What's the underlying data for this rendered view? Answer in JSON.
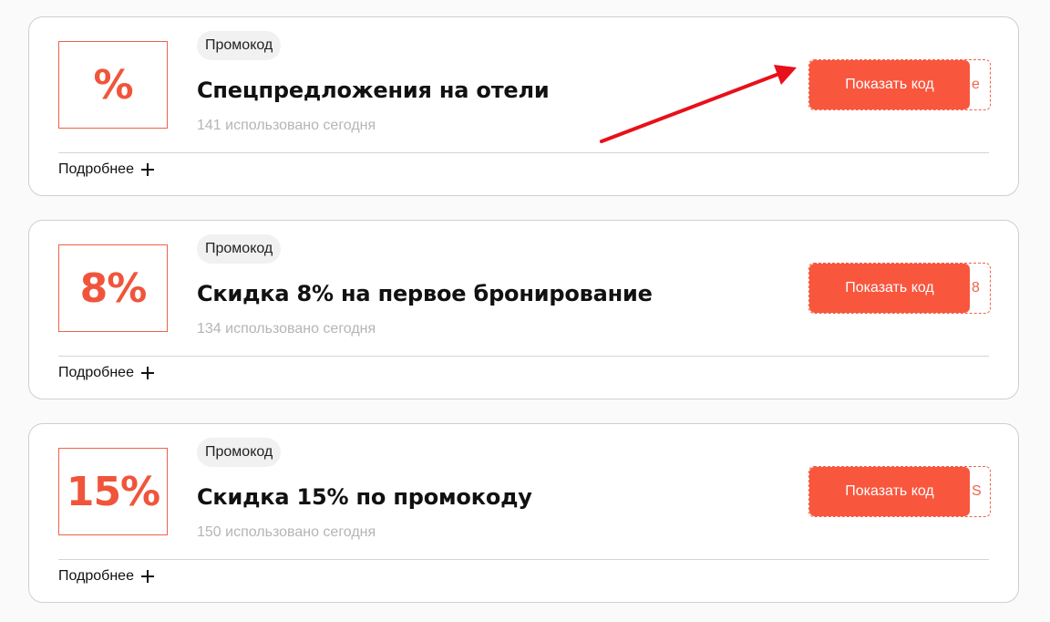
{
  "offers": [
    {
      "discount": "%",
      "badge": "Промокод",
      "title": "Спецпредложения на отели",
      "used": "141 использовано сегодня",
      "button_label": "Показать код",
      "code_peek": "e",
      "more_label": "Подробнее"
    },
    {
      "discount": "8%",
      "badge": "Промокод",
      "title": "Скидка 8% на первое бронирование",
      "used": "134 использовано сегодня",
      "button_label": "Показать код",
      "code_peek": "8",
      "more_label": "Подробнее"
    },
    {
      "discount": "15%",
      "badge": "Промокод",
      "title": "Скидка 15% по промокоду",
      "used": "150 использовано сегодня",
      "button_label": "Показать код",
      "code_peek": "S",
      "more_label": "Подробнее"
    }
  ],
  "colors": {
    "accent": "#f9563e",
    "annotation_arrow": "#e8101a"
  }
}
